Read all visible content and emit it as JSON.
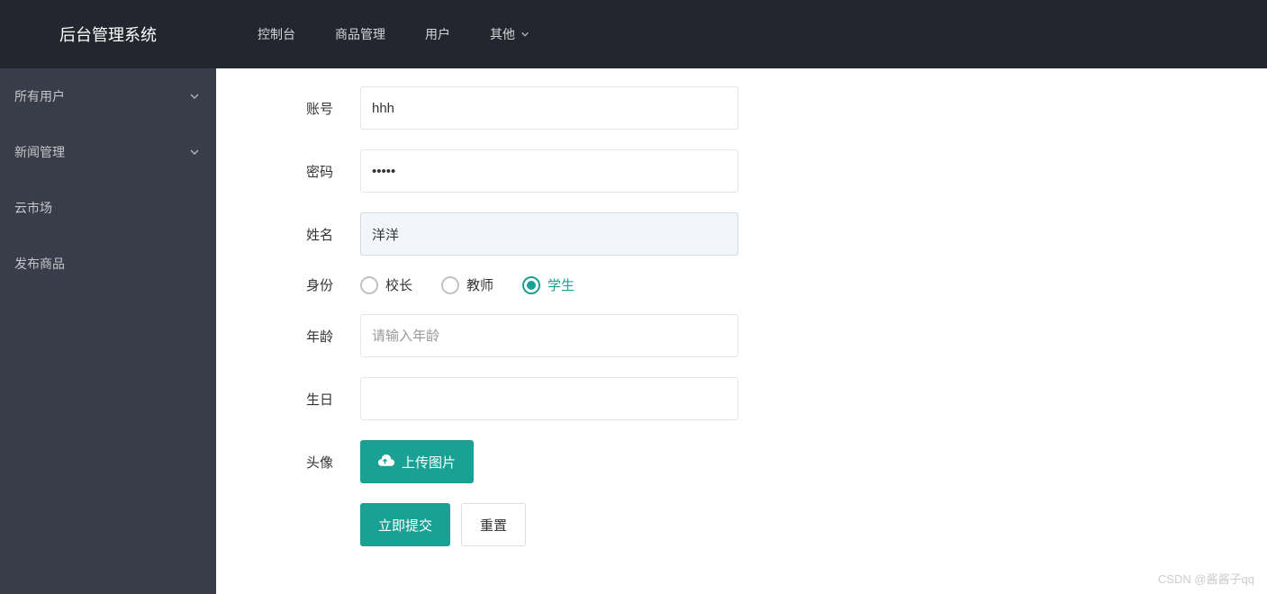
{
  "logo": "后台管理系统",
  "sidebar": {
    "items": [
      {
        "label": "所有用户",
        "expandable": true
      },
      {
        "label": "新闻管理",
        "expandable": true
      },
      {
        "label": "云市场",
        "expandable": false
      },
      {
        "label": "发布商品",
        "expandable": false
      }
    ]
  },
  "topnav": {
    "items": [
      {
        "label": "控制台"
      },
      {
        "label": "商品管理"
      },
      {
        "label": "用户"
      },
      {
        "label": "其他",
        "dropdown": true
      }
    ]
  },
  "form": {
    "account": {
      "label": "账号",
      "value": "hhh"
    },
    "password": {
      "label": "密码",
      "value": "•••••"
    },
    "name": {
      "label": "姓名",
      "value": "洋洋"
    },
    "role": {
      "label": "身份",
      "options": [
        {
          "label": "校长",
          "checked": false
        },
        {
          "label": "教师",
          "checked": false
        },
        {
          "label": "学生",
          "checked": true
        }
      ]
    },
    "age": {
      "label": "年龄",
      "placeholder": "请输入年龄",
      "value": ""
    },
    "birthday": {
      "label": "生日",
      "value": ""
    },
    "avatar": {
      "label": "头像",
      "button": "上传图片"
    },
    "actions": {
      "submit": "立即提交",
      "reset": "重置"
    }
  },
  "watermark": "CSDN @酱酱子qq"
}
